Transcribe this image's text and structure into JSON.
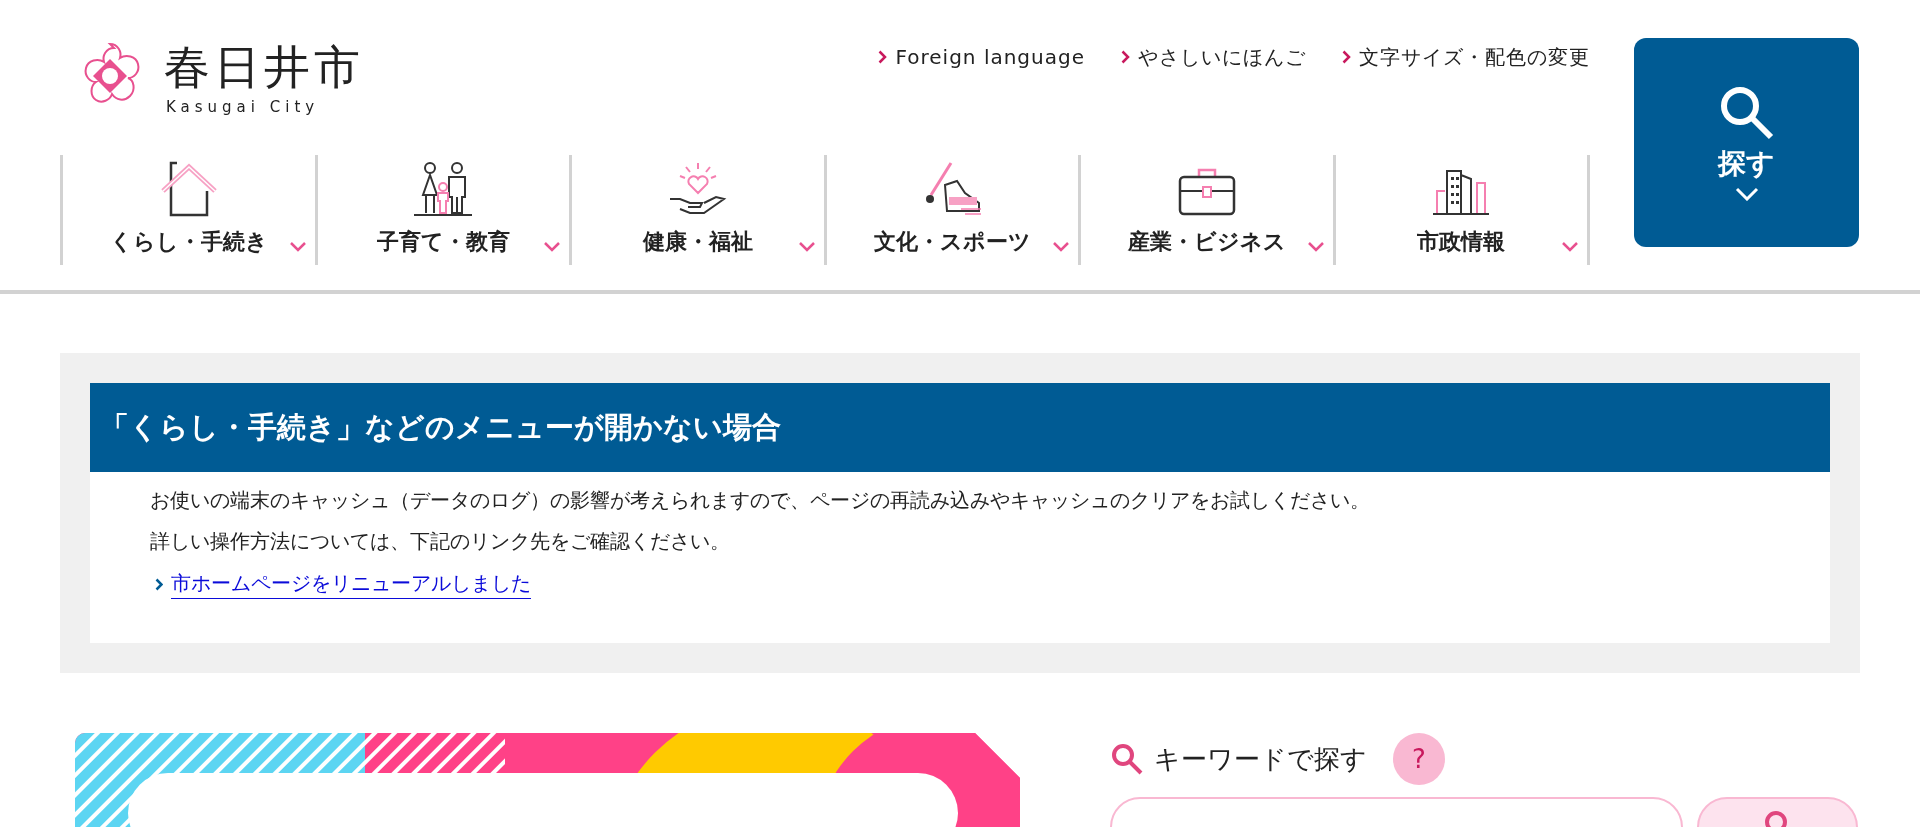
{
  "logo": {
    "title": "春日井市",
    "subtitle": "Kasugai City"
  },
  "utility_links": [
    "Foreign language",
    "やさしいにほんご",
    "文字サイズ・配色の変更"
  ],
  "search_button": {
    "label": "探す"
  },
  "nav": [
    {
      "label": "くらし・手続き"
    },
    {
      "label": "子育て・教育"
    },
    {
      "label": "健康・福祉"
    },
    {
      "label": "文化・スポーツ"
    },
    {
      "label": "産業・ビジネス"
    },
    {
      "label": "市政情報"
    }
  ],
  "notice": {
    "title": "「くらし・手続き」などのメニューが開かない場合",
    "lines": [
      "お使いの端末のキャッシュ（データのログ）の影響が考えられますので、ページの再読み込みやキャッシュのクリアをお試しください。",
      "詳しい操作方法については、下記のリンク先をご確認ください。"
    ],
    "link": "市ホームページをリニューアルしました"
  },
  "keyword_search": {
    "label": "キーワードで探す",
    "help": "?"
  }
}
